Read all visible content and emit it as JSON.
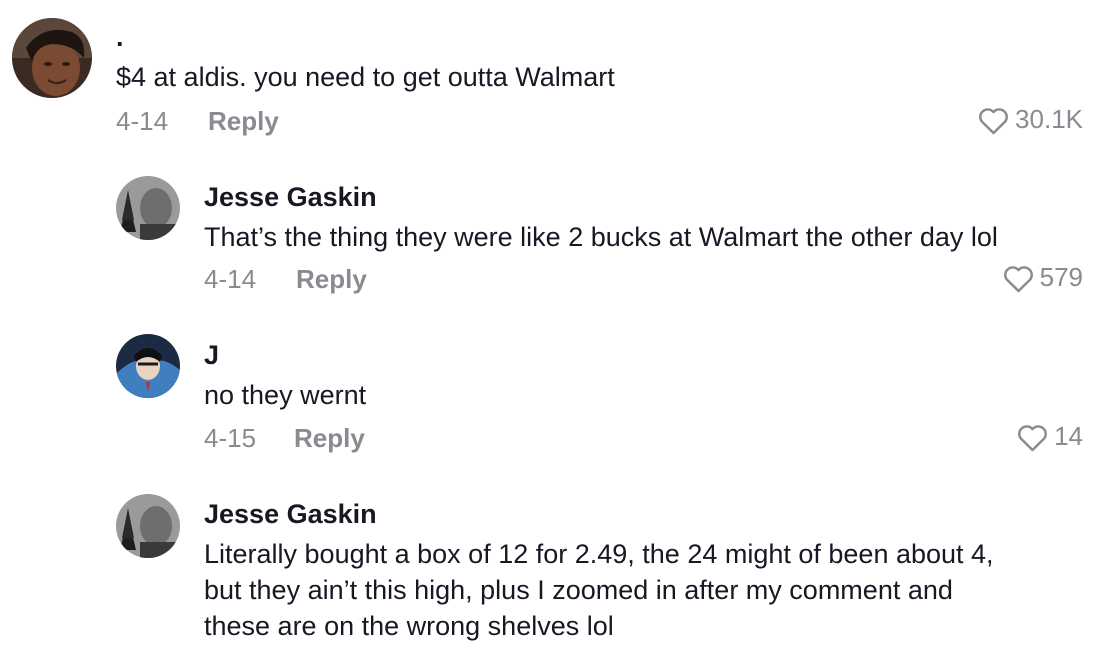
{
  "comments": [
    {
      "username": ".",
      "text": "$4 at aldis. you need to get outta Walmart",
      "date": "4-14",
      "reply_label": "Reply",
      "likes": "30.1K",
      "avatar": "user-photo-woman"
    },
    {
      "username": "Jesse Gaskin",
      "text": "That’s the thing they were like 2 bucks at Walmart the other day lol",
      "date": "4-14",
      "reply_label": "Reply",
      "likes": "579",
      "avatar": "user-photo-man-tree"
    },
    {
      "username": "J",
      "text": "no they wernt",
      "date": "4-15",
      "reply_label": "Reply",
      "likes": "14",
      "avatar": "cartoon-character"
    },
    {
      "username": "Jesse Gaskin",
      "text_lines": [
        "Literally bought a box of 12 for 2.49, the 24 might of been about 4,",
        "but they ain’t this high, plus I zoomed in after my comment and",
        "these are on the wrong shelves lol"
      ],
      "avatar": "user-photo-man-tree"
    }
  ],
  "icons": {
    "like": "heart-outline-icon"
  },
  "colors": {
    "text": "#161823",
    "secondary": "#8a8b91",
    "background": "#ffffff"
  }
}
